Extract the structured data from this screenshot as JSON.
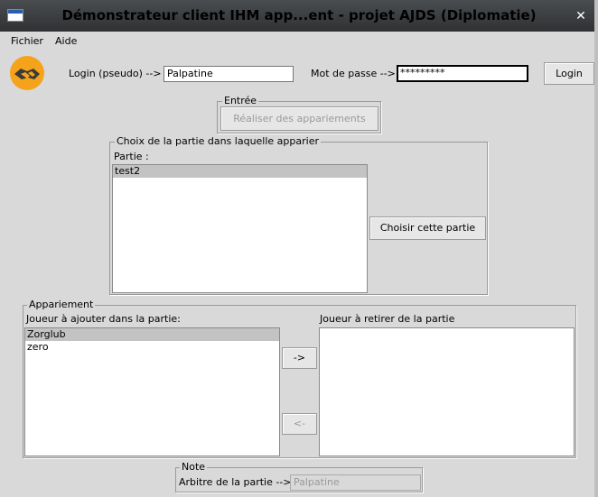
{
  "window": {
    "title": "Démonstrateur client IHM app...ent - projet AJDS (Diplomatie)",
    "close_glyph": "✕"
  },
  "menu": {
    "items": [
      "Fichier",
      "Aide"
    ]
  },
  "login": {
    "login_label": "Login (pseudo) -->",
    "login_value": "Palpatine",
    "password_label": "Mot de passe -->",
    "password_value": "*********",
    "login_button": "Login"
  },
  "entree": {
    "legend": "Entrée",
    "button": "Réaliser  des appariements"
  },
  "choix": {
    "legend": "Choix de la partie dans laquelle apparier",
    "list_label": "Partie :",
    "items": [
      "test2"
    ],
    "button": "Choisir cette partie"
  },
  "appariement": {
    "legend": "Appariement",
    "left_label": "Joueur à ajouter dans la partie:",
    "left_items": [
      "Zorglub",
      "zero"
    ],
    "right_label": "Joueur à retirer de la partie",
    "right_items": [],
    "add_button": "->",
    "remove_button": "<-"
  },
  "note": {
    "legend": "Note",
    "arbitre_label": "Arbitre de la partie -->",
    "arbitre_value": "Palpatine"
  },
  "colors": {
    "logo_bg": "#f5a31a",
    "titlebar": "#3a3c3e",
    "window_bg": "#d9d9d9"
  }
}
